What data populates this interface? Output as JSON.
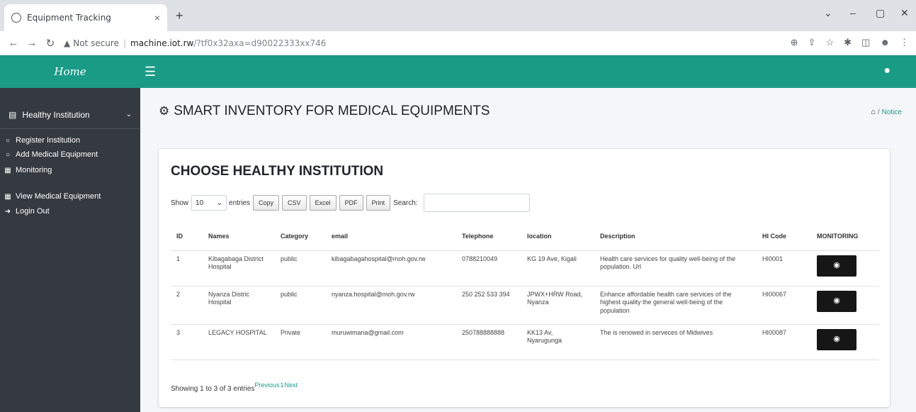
{
  "browser": {
    "tab_title": "Equipment Tracking",
    "tab_close": "×",
    "new_tab": "+",
    "not_secure": "Not secure",
    "url_host": "machine.iot.rw",
    "url_path": "/?tf0x32axa=d90022333xx746",
    "window_controls": [
      "⌄",
      "–",
      "▢",
      "✕"
    ],
    "nav_icons": [
      "back-icon",
      "forward-icon",
      "reload-icon"
    ]
  },
  "app": {
    "brand": "Home",
    "header_color": "#1a9b86",
    "sidebar_color": "#343a40",
    "accent": "#1a9b86"
  },
  "sidebar": {
    "parent_label": "Healthy Institution",
    "items": [
      {
        "label": "Register Institution",
        "icon": "circle-icon"
      },
      {
        "label": "Add Medical Equipment",
        "icon": "circle-icon"
      },
      {
        "label": "Monitoring",
        "icon": "table-icon"
      },
      {
        "label": "View Medical Equipment",
        "icon": "table-icon"
      },
      {
        "label": "Login Out",
        "icon": "sign-out-icon"
      }
    ]
  },
  "page": {
    "title": "SMART INVENTORY FOR MEDICAL EQUIPMENTS",
    "breadcrumb": {
      "sep": "/",
      "current": "Notice"
    }
  },
  "card": {
    "title": "CHOOSE HEALTHY INSTITUTION",
    "show_label": "Show",
    "page_length": "10",
    "entries_label": "entries",
    "buttons": [
      "Copy",
      "CSV",
      "Excel",
      "PDF",
      "Print"
    ],
    "search_label": "Search:",
    "search_value": ""
  },
  "table": {
    "columns": [
      "ID",
      "Names",
      "Category",
      "email",
      "Telephone",
      "location",
      "Description",
      "HI Code",
      "MONITORING"
    ],
    "rows": [
      {
        "id": "1",
        "name": "Kibagabaga District Hospital",
        "category": "public",
        "email": "kibagabagahospital@moh.gov.rw",
        "telephone": "0788210049",
        "location": "KG 19 Ave, Kigali",
        "description": "Health care services for quality well-being of the population. Url",
        "code": "HI0001"
      },
      {
        "id": "2",
        "name": "Nyanza Distric Hospital",
        "category": "public",
        "email": "nyanza.hospital@moh.gov.rw",
        "telephone": "250 252 533 394",
        "location": "JPWX+HRW Road, Nyanza",
        "description": "Enhance affordable health care services of the highest quality the general well-being of the population",
        "code": "HI00067"
      },
      {
        "id": "3",
        "name": "LEGACY HOSPITAL",
        "category": "Private",
        "email": "muruwimana@gmail.com",
        "telephone": "250788888888",
        "location": "KK13 Av, Nyarugunga",
        "description": "The is renowed in serveces of Midwives",
        "code": "HI00087"
      }
    ],
    "footer": "Showing 1 to 3 of 3 entries",
    "pager": [
      "Previous",
      "1",
      "Next"
    ]
  }
}
